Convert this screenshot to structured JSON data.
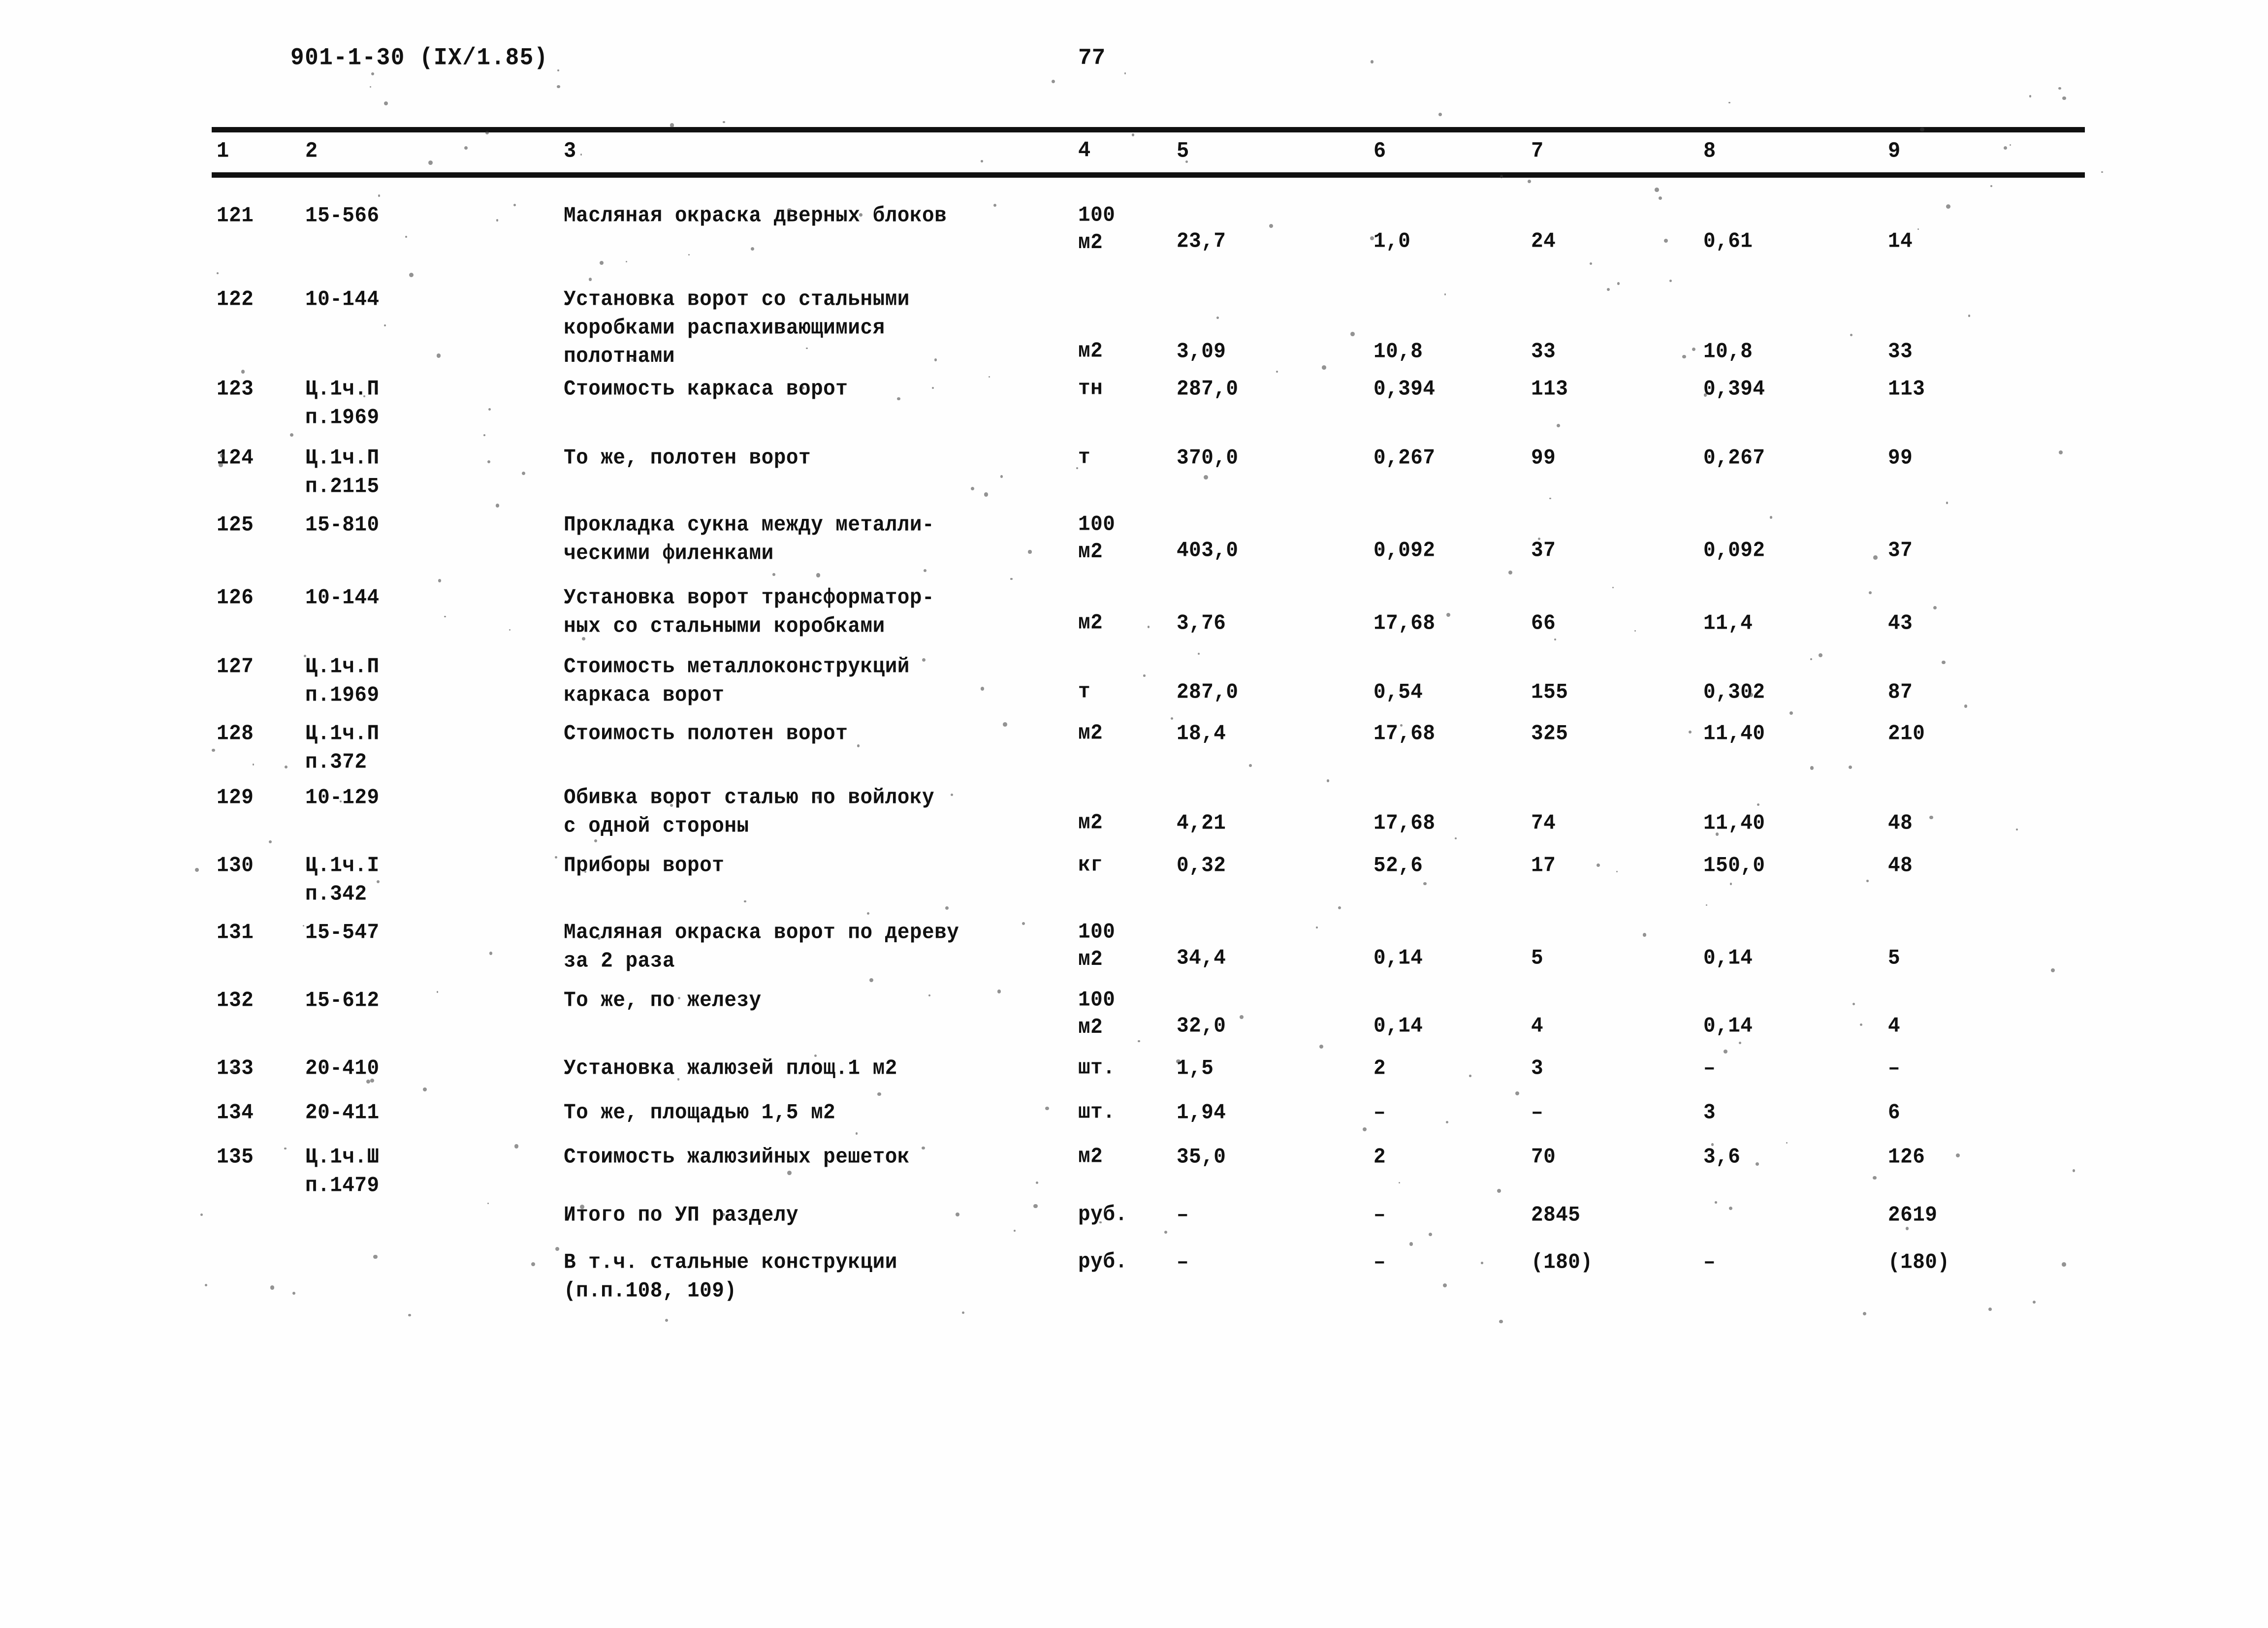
{
  "header": {
    "document_code": "901-1-30 (IX/1.85)",
    "page_number": "77"
  },
  "table": {
    "column_headers": [
      "1",
      "2",
      "3",
      "4",
      "5",
      "6",
      "7",
      "8",
      "9"
    ],
    "rows": [
      {
        "num": "121",
        "code": "15-566",
        "name": "Масляная окраска дверных блоков",
        "unit": "100\nм2",
        "c5": "23,7",
        "c6": "1,0",
        "c7": "24",
        "c8": "0,61",
        "c9": "14"
      },
      {
        "num": "122",
        "code": "10-144",
        "name": "Установка ворот со стальными\nкоробками распахивающимися\nполотнами",
        "unit": "м2",
        "c5": "3,09",
        "c6": "10,8",
        "c7": "33",
        "c8": "10,8",
        "c9": "33"
      },
      {
        "num": "123",
        "code": "Ц.1ч.П\nп.1969",
        "name": "Стоимость каркаса ворот",
        "unit": "тн",
        "c5": "287,0",
        "c6": "0,394",
        "c7": "113",
        "c8": "0,394",
        "c9": "113"
      },
      {
        "num": "124",
        "code": "Ц.1ч.П\nп.2115",
        "name": "То же, полотен ворот",
        "unit": "т",
        "c5": "370,0",
        "c6": "0,267",
        "c7": "99",
        "c8": "0,267",
        "c9": "99"
      },
      {
        "num": "125",
        "code": "15-810",
        "name": "Прокладка сукна между металли-\nческими филенками",
        "unit": "100\nм2",
        "c5": "403,0",
        "c6": "0,092",
        "c7": "37",
        "c8": "0,092",
        "c9": "37"
      },
      {
        "num": "126",
        "code": "10-144",
        "name": "Установка ворот трансформатор-\nных со стальными коробками",
        "unit": "м2",
        "c5": "3,76",
        "c6": "17,68",
        "c7": "66",
        "c8": "11,4",
        "c9": "43"
      },
      {
        "num": "127",
        "code": "Ц.1ч.П\nп.1969",
        "name": "Стоимость металлоконструкций\nкаркаса ворот",
        "unit": "т",
        "c5": "287,0",
        "c6": "0,54",
        "c7": "155",
        "c8": "0,302",
        "c9": "87"
      },
      {
        "num": "128",
        "code": "Ц.1ч.П\nп.372",
        "name": "Стоимость полотен ворот",
        "unit": "м2",
        "c5": "18,4",
        "c6": "17,68",
        "c7": "325",
        "c8": "11,40",
        "c9": "210"
      },
      {
        "num": "129",
        "code": "10-129",
        "name": "Обивка ворот сталью по войлоку\nс одной стороны",
        "unit": "м2",
        "c5": "4,21",
        "c6": "17,68",
        "c7": "74",
        "c8": "11,40",
        "c9": "48"
      },
      {
        "num": "130",
        "code": "Ц.1ч.I\nп.342",
        "name": "Приборы ворот",
        "unit": "кг",
        "c5": "0,32",
        "c6": "52,6",
        "c7": "17",
        "c8": "150,0",
        "c9": "48"
      },
      {
        "num": "131",
        "code": "15-547",
        "name": "Масляная окраска ворот по дереву\nза 2 раза",
        "unit": "100\nм2",
        "c5": "34,4",
        "c6": "0,14",
        "c7": "5",
        "c8": "0,14",
        "c9": "5"
      },
      {
        "num": "132",
        "code": "15-612",
        "name": "То же, по железу",
        "unit": "100\nм2",
        "c5": "32,0",
        "c6": "0,14",
        "c7": "4",
        "c8": "0,14",
        "c9": "4"
      },
      {
        "num": "133",
        "code": "20-410",
        "name": "Установка жалюзей площ.1 м2",
        "unit": "шт.",
        "c5": "1,5",
        "c6": "2",
        "c7": "3",
        "c8": "–",
        "c9": "–"
      },
      {
        "num": "134",
        "code": "20-411",
        "name": "То же, площадью 1,5 м2",
        "unit": "шт.",
        "c5": "1,94",
        "c6": "–",
        "c7": "–",
        "c8": "3",
        "c9": "6"
      },
      {
        "num": "135",
        "code": "Ц.1ч.Ш\nп.1479",
        "name": "Стоимость жалюзийных решеток",
        "unit": "м2",
        "c5": "35,0",
        "c6": "2",
        "c7": "70",
        "c8": "3,6",
        "c9": "126"
      },
      {
        "num": "",
        "code": "",
        "name": "Итого по УП разделу",
        "unit": "руб.",
        "c5": "–",
        "c6": "–",
        "c7": "2845",
        "c8": "",
        "c9": "2619"
      },
      {
        "num": "",
        "code": "",
        "name": "В т.ч. стальные конструкции\n(п.п.108, 109)",
        "unit": "руб.",
        "c5": "–",
        "c6": "–",
        "c7": "(180)",
        "c8": "–",
        "c9": "(180)"
      }
    ]
  }
}
